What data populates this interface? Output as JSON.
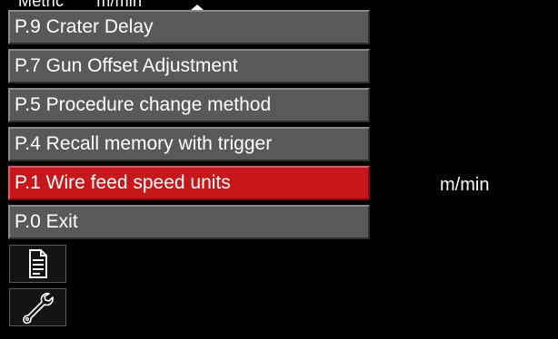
{
  "header": {
    "left_text": "Metric",
    "right_text": "m/min"
  },
  "menu": {
    "items": [
      {
        "label": "P.9 Crater Delay",
        "selected": false
      },
      {
        "label": "P.7 Gun Offset Adjustment",
        "selected": false
      },
      {
        "label": "P.5 Procedure change method",
        "selected": false
      },
      {
        "label": "P.4 Recall memory with trigger",
        "selected": false
      },
      {
        "label": "P.1 Wire feed speed units",
        "selected": true
      },
      {
        "label": "P.0 Exit",
        "selected": false
      }
    ]
  },
  "selected_value": "m/min",
  "tiles": [
    {
      "icon": "document-icon"
    },
    {
      "icon": "wrench-icon"
    }
  ],
  "colors": {
    "background": "#000000",
    "item": "#595959",
    "selected": "#c8171a",
    "text": "#ffffff"
  }
}
